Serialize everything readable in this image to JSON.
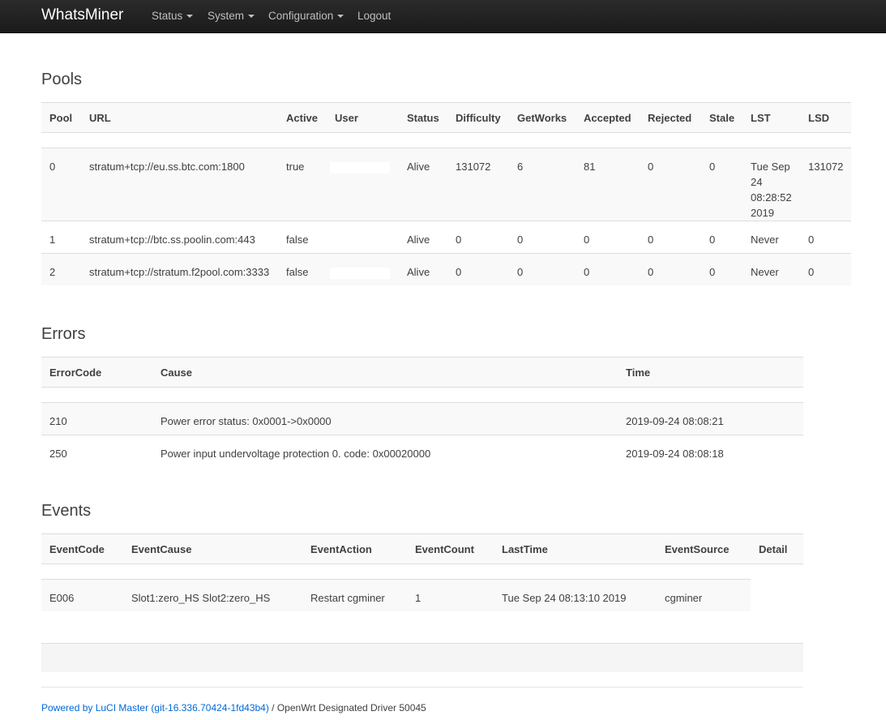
{
  "nav": {
    "brand": "WhatsMiner",
    "items": [
      "Status",
      "System",
      "Configuration",
      "Logout"
    ]
  },
  "pools": {
    "title": "Pools",
    "headers": [
      "Pool",
      "URL",
      "Active",
      "User",
      "Status",
      "Difficulty",
      "GetWorks",
      "Accepted",
      "Rejected",
      "Stale",
      "LST",
      "LSD"
    ],
    "rows": [
      [
        "0",
        "stratum+tcp://eu.ss.btc.com:1800",
        "true",
        "",
        "Alive",
        "131072",
        "6",
        "81",
        "0",
        "0",
        "Tue Sep 24 08:28:52 2019",
        "131072"
      ],
      [
        "1",
        "stratum+tcp://btc.ss.poolin.com:443",
        "false",
        "",
        "Alive",
        "0",
        "0",
        "0",
        "0",
        "0",
        "Never",
        "0"
      ],
      [
        "2",
        "stratum+tcp://stratum.f2pool.com:3333",
        "false",
        "",
        "Alive",
        "0",
        "0",
        "0",
        "0",
        "0",
        "Never",
        "0"
      ]
    ]
  },
  "errors": {
    "title": "Errors",
    "headers": [
      "ErrorCode",
      "Cause",
      "Time"
    ],
    "rows": [
      [
        "210",
        "Power error status: 0x0001->0x0000",
        "2019-09-24 08:08:21"
      ],
      [
        "250",
        "Power input undervoltage protection 0. code: 0x00020000",
        "2019-09-24 08:08:18"
      ]
    ]
  },
  "events": {
    "title": "Events",
    "headers": [
      "EventCode",
      "EventCause",
      "EventAction",
      "EventCount",
      "LastTime",
      "EventSource",
      "Detail"
    ],
    "rows": [
      [
        "E006",
        "Slot1:zero_HS Slot2:zero_HS",
        "Restart cgminer",
        "1",
        "Tue Sep 24 08:13:10 2019",
        "cgminer"
      ]
    ]
  },
  "footer": {
    "link": "Powered by LuCI Master (git-16.336.70424-1fd43b4)",
    "text": " / OpenWrt Designated Driver 50045"
  }
}
